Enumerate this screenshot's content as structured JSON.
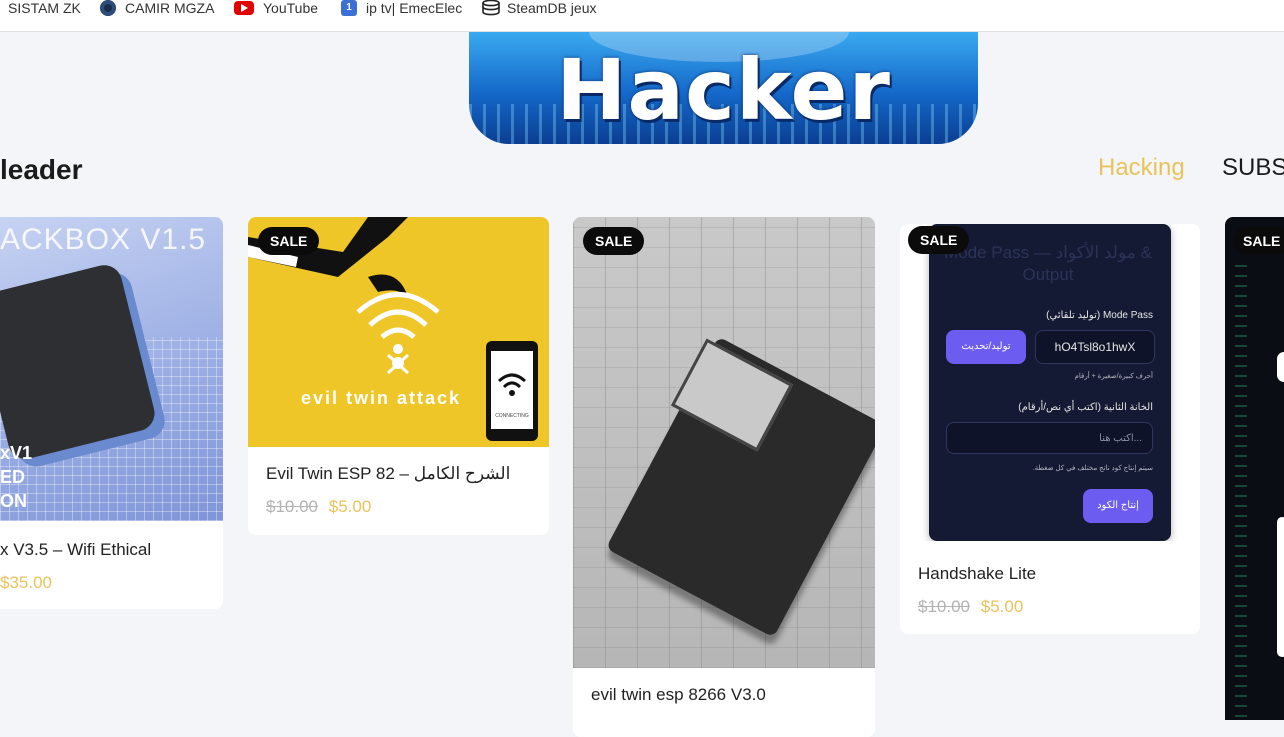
{
  "bookmarks": [
    {
      "label": "SISTAM ZK",
      "icon": "none"
    },
    {
      "label": "CAMIR MGZA",
      "icon": "camir-favicon-icon"
    },
    {
      "label": "YouTube",
      "icon": "youtube-icon"
    },
    {
      "label": "ip tv| EmecElec",
      "icon": "iptv-favicon-icon"
    },
    {
      "label": "SteamDB jeux",
      "icon": "steamdb-icon"
    }
  ],
  "banner": {
    "title": "Hacker"
  },
  "header": {
    "site_name": "leader",
    "nav": [
      {
        "label": "Hacking",
        "color": "#e8c35a"
      },
      {
        "label": "SUBSC"
      }
    ]
  },
  "colors": {
    "accent": "#e8c35a",
    "sale_badge": "#0b0b0b",
    "button": "#6d5cf0"
  },
  "products": [
    {
      "name": "x V3.5 – Wifi Ethical",
      "price_new": "$35.00",
      "image": {
        "brand_text": "ACKBOX V1.5",
        "side_text": [
          "xV1",
          "ED",
          "ON"
        ]
      }
    },
    {
      "name": "Evil Twin ESP 82 – الشرح الكامل",
      "price_old": "$10.00",
      "price_new": "$5.00",
      "sale": "SALE",
      "image": {
        "caption": "evil twin attack",
        "phone_text": "CONNECTING"
      }
    },
    {
      "name": "evil twin esp 8266 V3.0",
      "sale": "SALE"
    },
    {
      "name": "Handshake Lite",
      "price_old": "$10.00",
      "price_new": "$5.00",
      "sale": "SALE",
      "panel": {
        "title": "Mode Pass — مولد الأكواد & Output",
        "mode_label": "Mode Pass (توليد تلقائي)",
        "generated_value": "hO4Tsl8o1hwX",
        "generate_button": "توليد/تحديث",
        "hint1": "أحرف كبيرة/صغيرة + أرقام",
        "second_label": "الخانة الثانية (اكتب أي نص/أرقام)",
        "second_placeholder": "اكتب هنا...",
        "hint2": "سيتم إنتاج كود ناتج مختلف في كل ضغطة.",
        "produce_button": "إنتاج الكود"
      }
    },
    {
      "sale": "SALE"
    }
  ]
}
